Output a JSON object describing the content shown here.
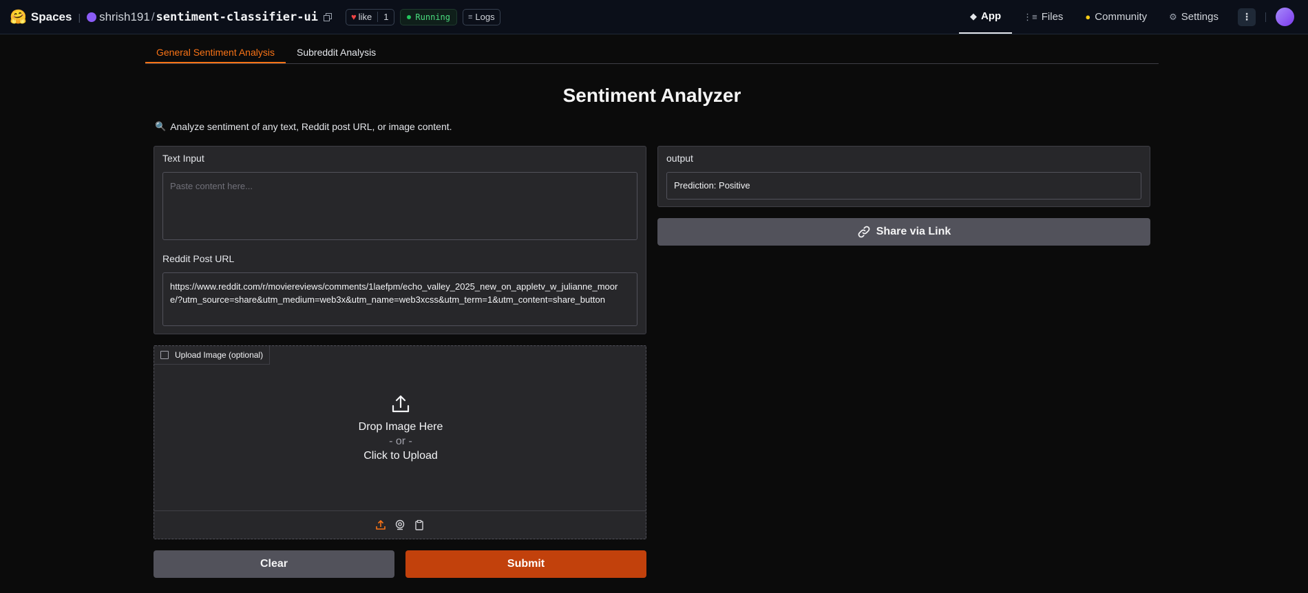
{
  "navbar": {
    "brand": "Spaces",
    "owner": "shrish191",
    "slash": "/",
    "repo": "sentiment-classifier-ui",
    "like_label": "like",
    "like_count": "1",
    "status": "Running",
    "logs": "Logs",
    "tabs": [
      {
        "label": "App",
        "icon": "cube-icon",
        "active": true
      },
      {
        "label": "Files",
        "icon": "files-icon",
        "active": false
      },
      {
        "label": "Community",
        "icon": "community-icon",
        "active": false
      },
      {
        "label": "Settings",
        "icon": "gear-icon",
        "active": false
      }
    ]
  },
  "app": {
    "tabs": [
      {
        "label": "General Sentiment Analysis",
        "active": true
      },
      {
        "label": "Subreddit Analysis",
        "active": false
      }
    ],
    "title": "Sentiment Analyzer",
    "intro": "Analyze sentiment of any text, Reddit post URL, or image content.",
    "text_input": {
      "label": "Text Input",
      "placeholder": "Paste content here...",
      "value": ""
    },
    "reddit_url": {
      "label": "Reddit Post URL",
      "value": "https://www.reddit.com/r/moviereviews/comments/1laefpm/echo_valley_2025_new_on_appletv_w_julianne_moore/?utm_source=share&utm_medium=web3x&utm_name=web3xcss&utm_term=1&utm_content=share_button"
    },
    "upload": {
      "label": "Upload Image (optional)",
      "drop": "Drop Image Here",
      "or": "- or -",
      "click": "Click to Upload",
      "sources": [
        "upload-icon",
        "webcam-icon",
        "clipboard-icon"
      ]
    },
    "buttons": {
      "clear": "Clear",
      "submit": "Submit"
    },
    "output": {
      "label": "output",
      "value": "Prediction: Positive"
    },
    "share": "Share via Link"
  },
  "colors": {
    "accent": "#f97316",
    "submit": "#c2410c",
    "status_green": "#22c55e"
  }
}
